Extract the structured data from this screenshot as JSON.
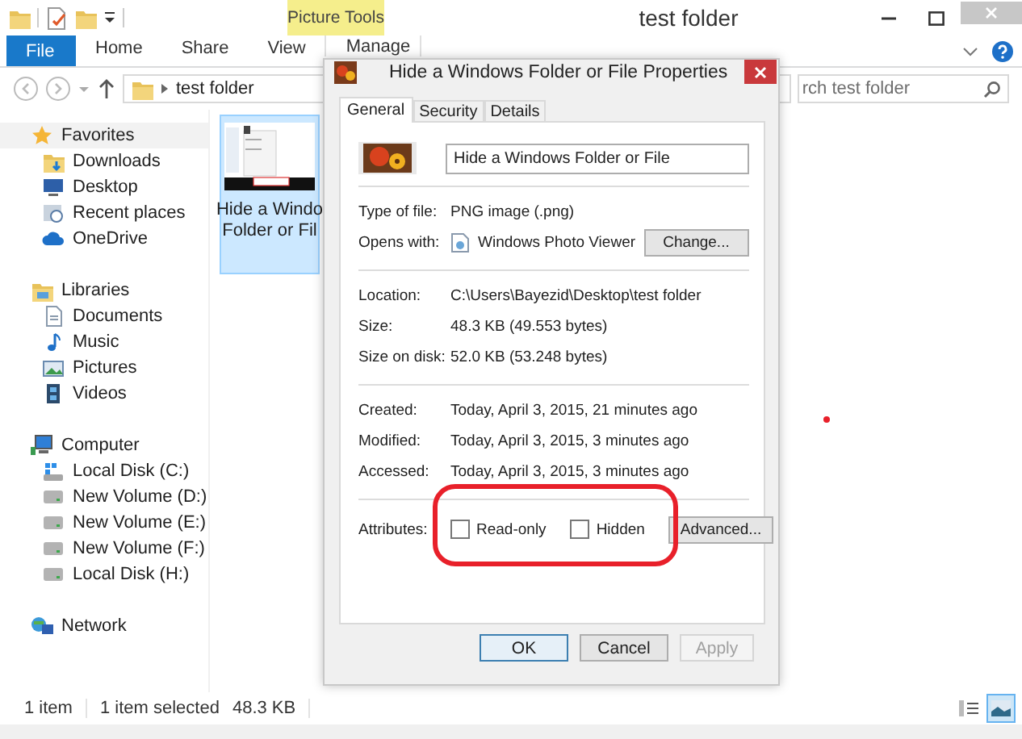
{
  "window": {
    "title": "test folder",
    "contextual_tab": "Picture Tools"
  },
  "ribbon_tabs": [
    {
      "label": "File",
      "kind": "file"
    },
    {
      "label": "Home",
      "kind": "plain"
    },
    {
      "label": "Share",
      "kind": "plain"
    },
    {
      "label": "View",
      "kind": "plain"
    },
    {
      "label": "Manage",
      "kind": "contextual"
    }
  ],
  "address_bar": {
    "path": "test folder"
  },
  "search": {
    "placeholder": "rch test folder"
  },
  "nav": [
    {
      "label": "Favorites",
      "kind": "star",
      "selected": true,
      "children": [
        {
          "label": "Downloads",
          "kind": "downloads",
          "selected": false
        },
        {
          "label": "Desktop",
          "kind": "desktop",
          "selected": false
        },
        {
          "label": "Recent places",
          "kind": "recent",
          "selected": false
        },
        {
          "label": "OneDrive",
          "kind": "cloud",
          "selected": false
        }
      ]
    },
    {
      "label": "Libraries",
      "kind": "library",
      "selected": false,
      "children": [
        {
          "label": "Documents",
          "kind": "document",
          "selected": false
        },
        {
          "label": "Music",
          "kind": "music",
          "selected": false
        },
        {
          "label": "Pictures",
          "kind": "pictures",
          "selected": false
        },
        {
          "label": "Videos",
          "kind": "videos",
          "selected": false
        }
      ]
    },
    {
      "label": "Computer",
      "kind": "computer",
      "selected": false,
      "children": [
        {
          "label": "Local Disk (C:)",
          "kind": "system-drive",
          "selected": false
        },
        {
          "label": "New Volume (D:)",
          "kind": "drive",
          "selected": false
        },
        {
          "label": "New Volume (E:)",
          "kind": "drive",
          "selected": false
        },
        {
          "label": "New Volume (F:)",
          "kind": "drive",
          "selected": false
        },
        {
          "label": "Local Disk (H:)",
          "kind": "drive",
          "selected": false
        }
      ]
    },
    {
      "label": "Network",
      "kind": "network",
      "selected": false
    }
  ],
  "files": [
    {
      "lines": [
        "Hide a Windo",
        "Folder or Fil"
      ],
      "selected": true
    }
  ],
  "status_bar": {
    "count": "1 item",
    "selection": "1 item selected",
    "size": "48.3 KB"
  },
  "views": [
    {
      "kind": "details",
      "selected": false
    },
    {
      "kind": "large-icons",
      "selected": true
    }
  ],
  "dialog": {
    "title": "Hide a Windows Folder or File Properties",
    "tabs": [
      {
        "label": "General",
        "selected": true
      },
      {
        "label": "Security",
        "selected": false
      },
      {
        "label": "Details",
        "selected": false
      }
    ],
    "file_name": "Hide a Windows Folder or File",
    "sections": [
      [
        {
          "label": "Type of file:",
          "value": "PNG image (.png)",
          "kind": "text"
        },
        {
          "label": "Opens with:",
          "value": "Windows Photo Viewer",
          "kind": "app",
          "button": "Change..."
        }
      ],
      [
        {
          "label": "Location:",
          "value": "C:\\Users\\Bayezid\\Desktop\\test folder",
          "kind": "text"
        },
        {
          "label": "Size:",
          "value": "48.3 KB (49.553 bytes)",
          "kind": "text"
        },
        {
          "label": "Size on disk:",
          "value": "52.0 KB (53.248 bytes)",
          "kind": "text"
        }
      ],
      [
        {
          "label": "Created:",
          "value": "Today, April 3, 2015, 21 minutes ago",
          "kind": "text"
        },
        {
          "label": "Modified:",
          "value": "Today, April 3, 2015, 3 minutes ago",
          "kind": "text"
        },
        {
          "label": "Accessed:",
          "value": "Today, April 3, 2015, 3 minutes ago",
          "kind": "text"
        }
      ]
    ],
    "attributes": {
      "label": "Attributes:",
      "checkboxes": [
        {
          "label": "Read-only",
          "checked": false
        },
        {
          "label": "Hidden",
          "checked": false
        }
      ],
      "button": "Advanced..."
    },
    "buttons": [
      {
        "label": "OK",
        "default": true,
        "disabled": false
      },
      {
        "label": "Cancel",
        "default": false,
        "disabled": false
      },
      {
        "label": "Apply",
        "default": false,
        "disabled": true
      }
    ]
  },
  "annotations": {
    "outline": true,
    "dot": true
  }
}
